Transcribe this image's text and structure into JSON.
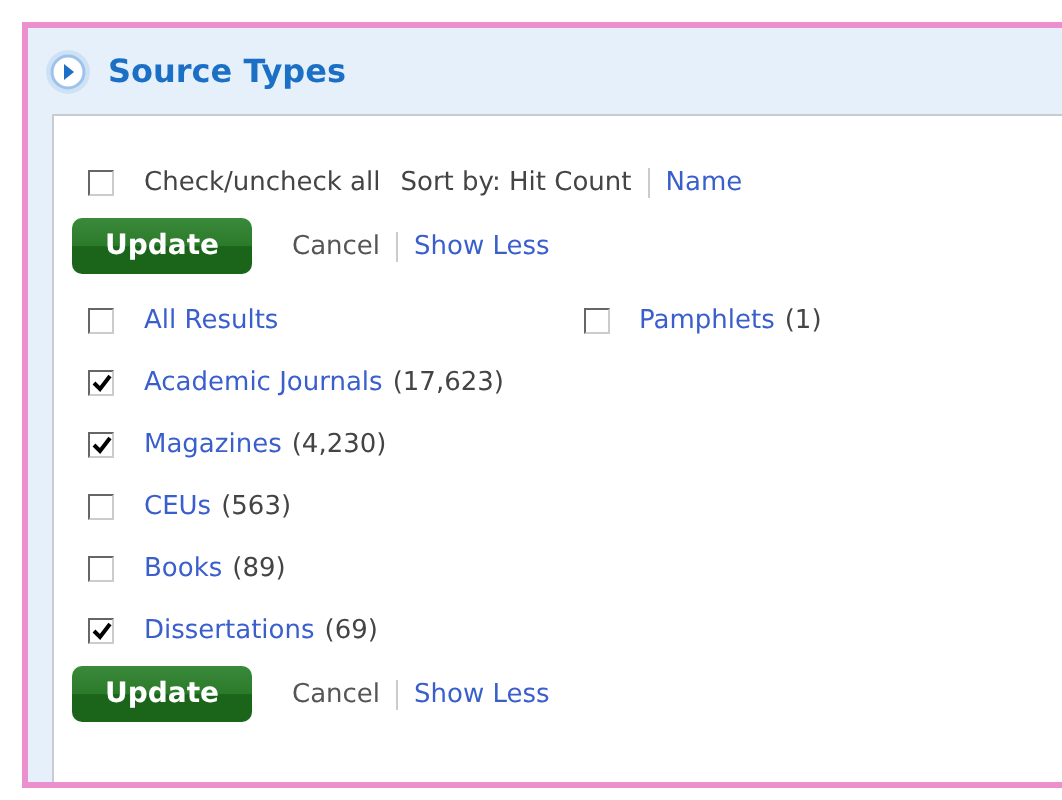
{
  "panel": {
    "title": "Source Types"
  },
  "check_all": {
    "label": "Check/uncheck all",
    "checked": false
  },
  "sort": {
    "label": "Sort by: Hit Count",
    "link": "Name"
  },
  "actions_top": {
    "update": "Update",
    "cancel": "Cancel",
    "toggle": "Show Less"
  },
  "columns": [
    [
      {
        "label": "All Results",
        "checked": false
      },
      {
        "label": "Academic Journals",
        "count": "(17,623)",
        "checked": true
      },
      {
        "label": "Magazines",
        "count": "(4,230)",
        "checked": true
      },
      {
        "label": "CEUs",
        "count": "(563)",
        "checked": false
      },
      {
        "label": "Books",
        "count": "(89)",
        "checked": false
      },
      {
        "label": "Dissertations",
        "count": "(69)",
        "checked": true
      }
    ],
    [
      {
        "label": "Pamphlets",
        "count": "(1)",
        "checked": false
      }
    ]
  ],
  "actions_bottom": {
    "update": "Update",
    "cancel": "Cancel",
    "toggle": "Show Less"
  }
}
